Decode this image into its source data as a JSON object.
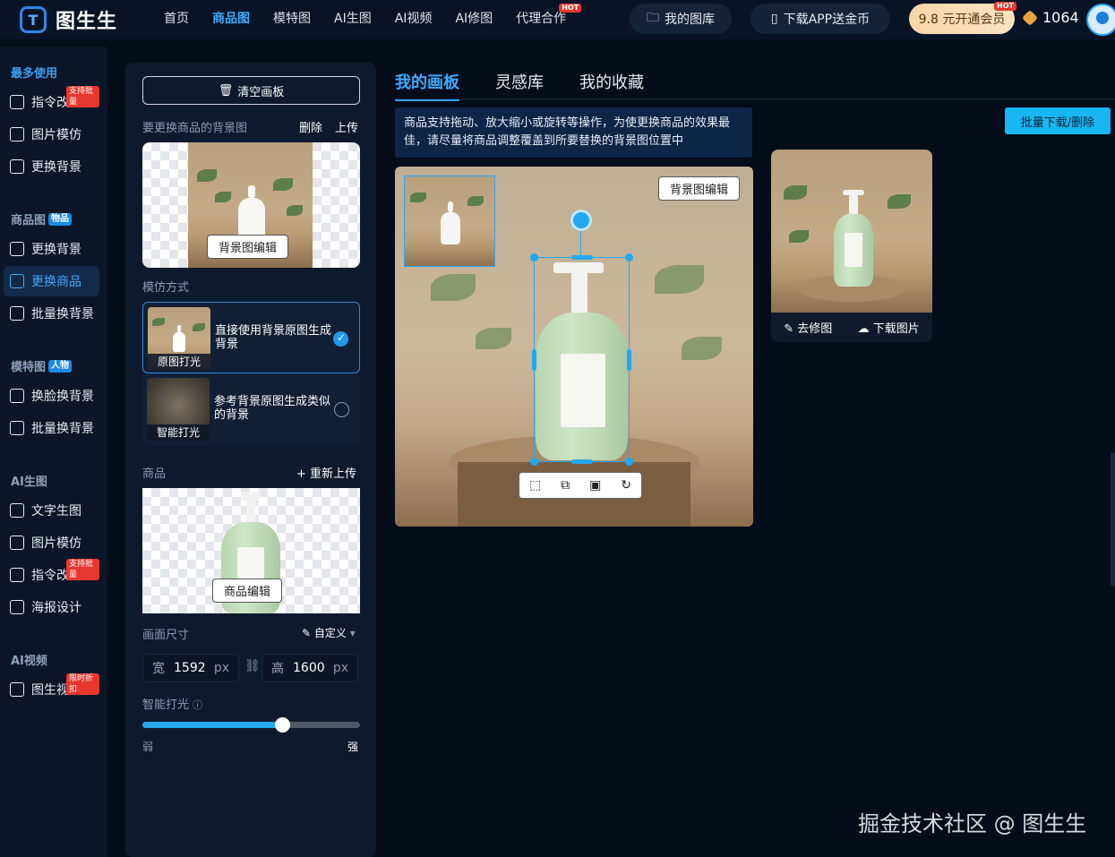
{
  "app": {
    "name": "图生生"
  },
  "nav": {
    "items": [
      {
        "label": "首页"
      },
      {
        "label": "商品图",
        "active": true
      },
      {
        "label": "模特图"
      },
      {
        "label": "AI生图"
      },
      {
        "label": "AI视频"
      },
      {
        "label": "AI修图"
      },
      {
        "label": "代理合作",
        "badge": "HOT"
      }
    ],
    "gallery": "我的图库",
    "download_app": "下载APP送金币",
    "vip": "9.8 元开通会员",
    "vip_badge": "HOT",
    "coins": "1064"
  },
  "sidebar": {
    "sections": [
      {
        "title": "最多使用",
        "items": [
          {
            "label": "指令改图",
            "badge": "支持批量"
          },
          {
            "label": "图片模仿"
          },
          {
            "label": "更换背景"
          }
        ]
      },
      {
        "title": "商品图",
        "tag": "物品",
        "items": [
          {
            "label": "更换背景"
          },
          {
            "label": "更换商品",
            "active": true
          },
          {
            "label": "批量换背景"
          }
        ]
      },
      {
        "title": "模特图",
        "tag": "人物",
        "items": [
          {
            "label": "换脸换背景"
          },
          {
            "label": "批量换背景"
          }
        ]
      },
      {
        "title": "AI生图",
        "items": [
          {
            "label": "文字生图"
          },
          {
            "label": "图片模仿"
          },
          {
            "label": "指令改图",
            "badge": "支持批量"
          },
          {
            "label": "海报设计"
          }
        ]
      },
      {
        "title": "AI视频",
        "items": [
          {
            "label": "图生视频",
            "badge": "限时折扣"
          }
        ]
      }
    ]
  },
  "panel": {
    "clear_button": "清空画板",
    "bg_section": "要更换商品的背景图",
    "bg_delete": "删除",
    "bg_upload": "上传",
    "bg_edit": "背景图编辑",
    "mimic_section": "模仿方式",
    "options": [
      {
        "caption": "原图打光",
        "text": "直接使用背景原图生成背景",
        "selected": true
      },
      {
        "caption": "智能打光",
        "text": "参考背景原图生成类似的背景",
        "selected": false
      }
    ],
    "product_section": "商品",
    "product_reupload": "+ 重新上传",
    "product_edit": "商品编辑",
    "size_section": "画面尺寸",
    "size_custom": "自定义",
    "width_label": "宽",
    "width_value": "1592",
    "height_label": "高",
    "height_value": "1600",
    "unit": "px",
    "light_section": "智能打光",
    "light_level": 0.64,
    "light_weak": "弱",
    "light_strong": "强"
  },
  "main": {
    "tabs": [
      {
        "label": "我的画板",
        "active": true
      },
      {
        "label": "灵感库"
      },
      {
        "label": "我的收藏"
      }
    ],
    "notice": "商品支持拖动、放大缩小或旋转等操作，为使更换商品的效果最佳，请尽量将商品调整覆盖到所要替换的背景图位置中",
    "batch_button": "批量下载/删除",
    "canvas_bg_edit": "背景图编辑",
    "result_retouch": "去修图",
    "result_download": "下载图片"
  },
  "watermark": "掘金技术社区 @ 图生生",
  "colors": {
    "accent": "#2a9df4",
    "background": "#040d19",
    "hot": "#e8372e"
  }
}
